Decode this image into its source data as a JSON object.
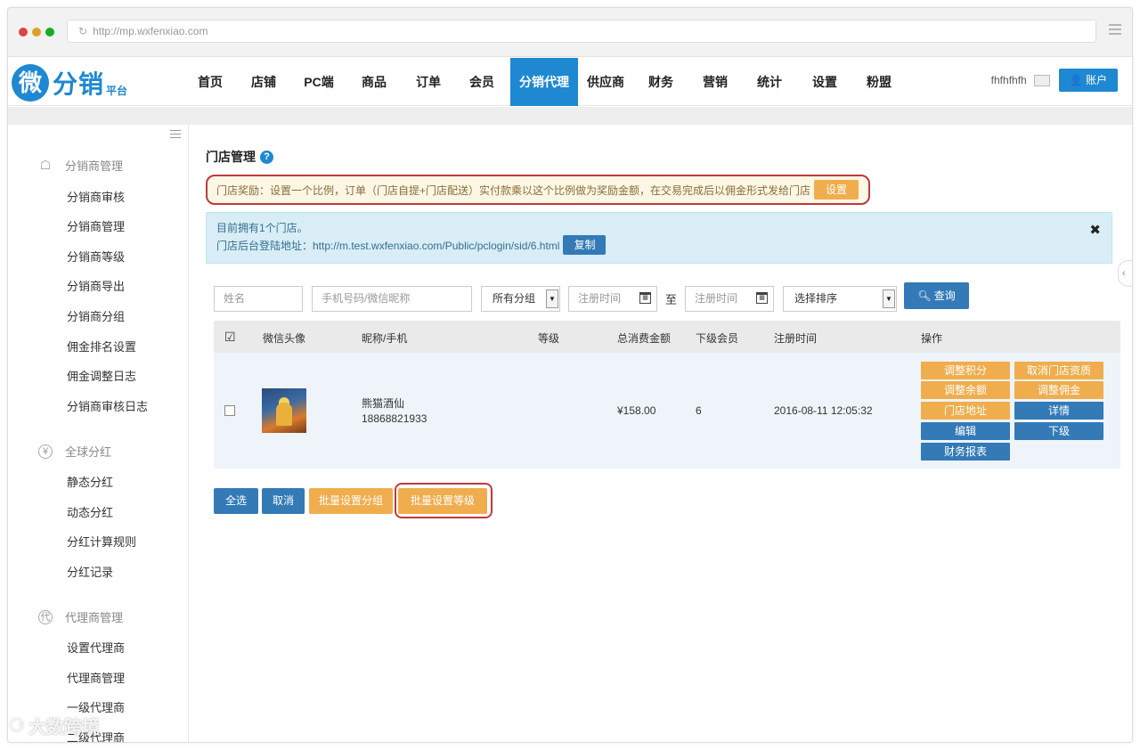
{
  "browser": {
    "url": "http://mp.wxfenxiao.com",
    "dot_colors": [
      "#e0443e",
      "#dea123",
      "#1aab29"
    ]
  },
  "logo": {
    "mark": "微",
    "name": "分销",
    "sub": "平台"
  },
  "nav": {
    "items": [
      "首页",
      "店铺",
      "PC端",
      "商品",
      "订单",
      "会员",
      "分销代理",
      "供应商",
      "财务",
      "营销",
      "统计",
      "设置",
      "粉盟"
    ],
    "active": "分销代理",
    "username": "fhfhfhfh",
    "account_label": "账户"
  },
  "sidebar": {
    "sections": [
      {
        "title": "分销商管理",
        "icon": "org-tree-icon",
        "items": [
          "分销商审核",
          "分销商管理",
          "分销商等级",
          "分销商导出",
          "分销商分组",
          "佣金排名设置",
          "佣金调整日志",
          "分销商审核日志"
        ]
      },
      {
        "title": "全球分红",
        "icon": "yen-icon",
        "items": [
          "静态分红",
          "动态分红",
          "分红计算规则",
          "分红记录"
        ]
      },
      {
        "title": "代理商管理",
        "icon": "agent-icon",
        "items": [
          "设置代理商",
          "代理商管理",
          "一级代理商",
          "二级代理商"
        ]
      }
    ]
  },
  "main": {
    "title": "门店管理",
    "reward_text": "门店奖励：设置一个比例，订单（门店自提+门店配送）实付款乘以这个比例做为奖励金额，在交易完成后以佣金形式发给门店",
    "reward_button": "设置",
    "info_line1": "目前拥有1个门店。",
    "info_line2": "门店后台登陆地址：http://m.test.wxfenxiao.com/Public/pclogin/sid/6.html",
    "copy_button": "复制",
    "close": "✖"
  },
  "filters": {
    "name_placeholder": "姓名",
    "phone_placeholder": "手机号码/微信昵称",
    "group_value": "所有分组",
    "date_from_placeholder": "注册时间",
    "date_to_placeholder": "注册时间",
    "to_label": "至",
    "sort_value": "选择排序",
    "query_button": "查询"
  },
  "table": {
    "headers": [
      "微信头像",
      "昵称/手机",
      "等级",
      "总消费金额",
      "下级会员",
      "注册时间",
      "操作"
    ],
    "rows": [
      {
        "nickname": "熊猫酒仙",
        "phone": "18868821933",
        "level": "",
        "total": "¥158.00",
        "sub_members": "6",
        "reg_time": "2016-08-11 12:05:32",
        "ops": [
          "调整积分",
          "取消门店资质",
          "调整余额",
          "调整佣金",
          "门店地址",
          "详情",
          "编辑",
          "下级",
          "财务报表"
        ]
      }
    ]
  },
  "bottom_buttons": [
    "全选",
    "取消",
    "批量设置分组",
    "批量设置等级"
  ],
  "watermark": "大数跨境"
}
